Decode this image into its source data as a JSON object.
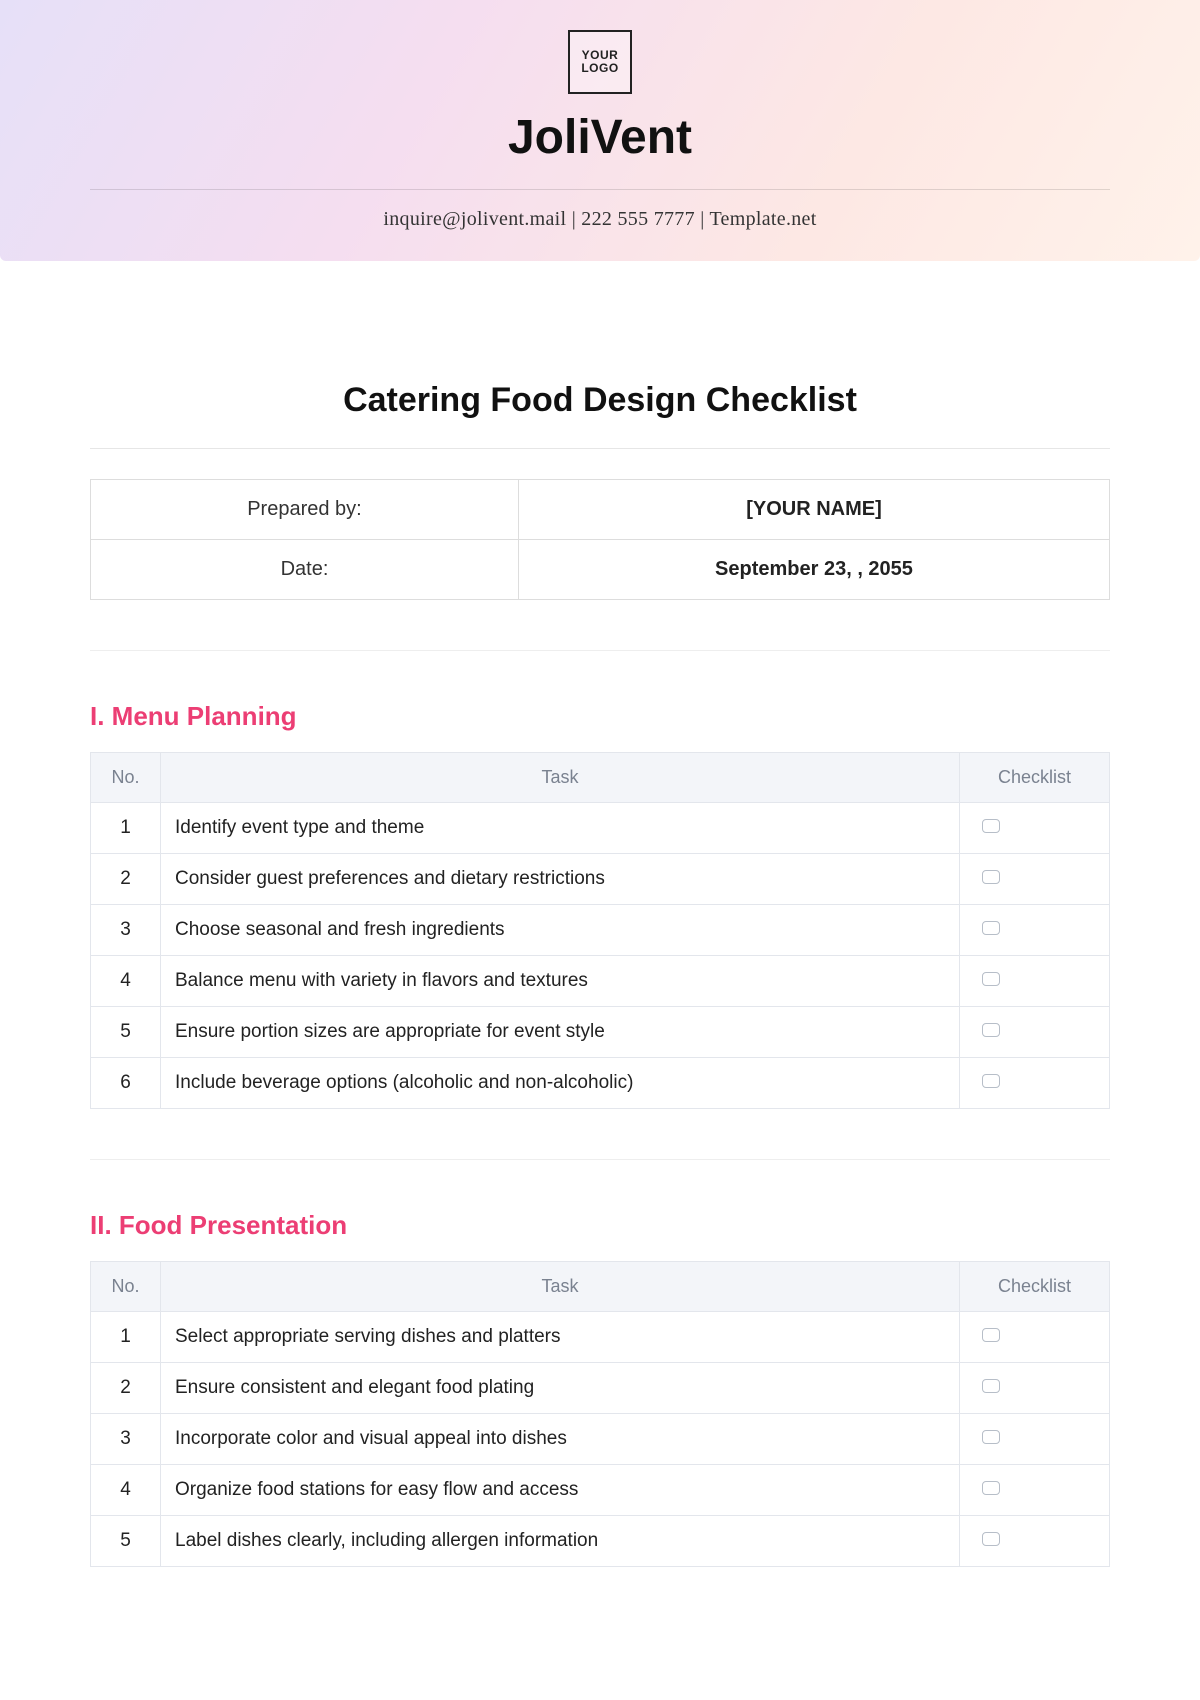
{
  "logo_text": "YOUR LOGO",
  "brand": "JoliVent",
  "contact_line": "inquire@jolivent.mail | 222 555 7777 | Template.net",
  "doc_title": "Catering Food Design Checklist",
  "meta": {
    "prepared_by_label": "Prepared by:",
    "prepared_by_value": "[YOUR NAME]",
    "date_label": "Date:",
    "date_value": "September 23, , 2055"
  },
  "headers": {
    "no": "No.",
    "task": "Task",
    "checklist": "Checklist"
  },
  "sections": [
    {
      "title": "I. Menu Planning",
      "rows": [
        {
          "no": "1",
          "task": "Identify event type and theme"
        },
        {
          "no": "2",
          "task": "Consider guest preferences and dietary restrictions"
        },
        {
          "no": "3",
          "task": "Choose seasonal and fresh ingredients"
        },
        {
          "no": "4",
          "task": "Balance menu with variety in flavors and textures"
        },
        {
          "no": "5",
          "task": "Ensure portion sizes are appropriate for event style"
        },
        {
          "no": "6",
          "task": "Include beverage options (alcoholic and non-alcoholic)"
        }
      ]
    },
    {
      "title": "II. Food Presentation",
      "rows": [
        {
          "no": "1",
          "task": "Select appropriate serving dishes and platters"
        },
        {
          "no": "2",
          "task": "Ensure consistent and elegant food plating"
        },
        {
          "no": "3",
          "task": "Incorporate color and visual appeal into dishes"
        },
        {
          "no": "4",
          "task": "Organize food stations for easy flow and access"
        },
        {
          "no": "5",
          "task": "Label dishes clearly, including allergen information"
        }
      ]
    }
  ]
}
